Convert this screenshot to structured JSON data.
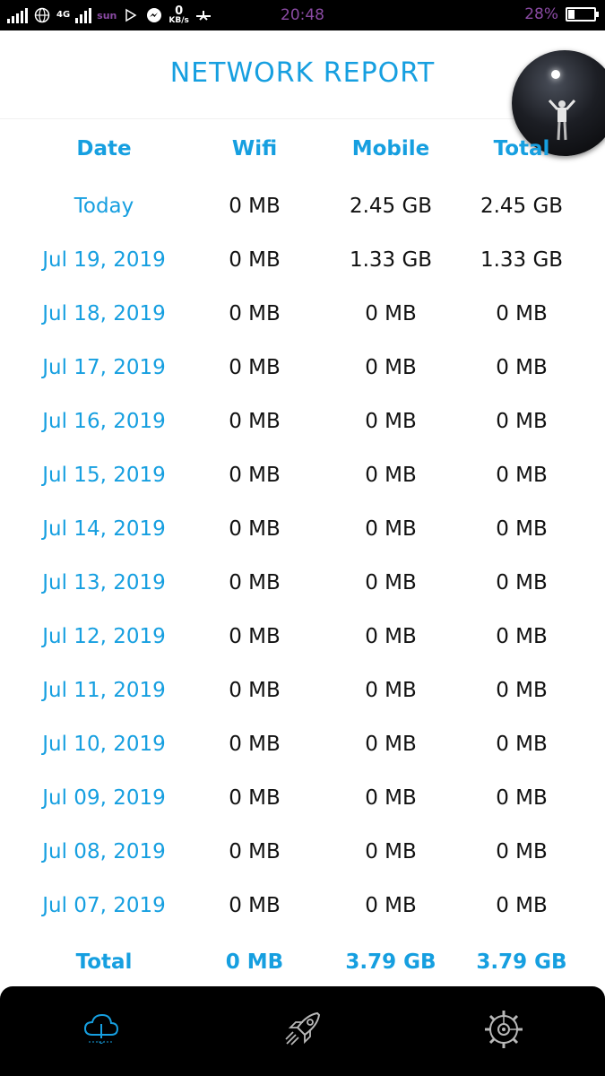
{
  "status_bar": {
    "network_tag": "4G",
    "carrier_label": "sun",
    "speed_value": "0",
    "speed_unit": "KB/s",
    "time": "20:48",
    "battery_percent": "28%",
    "battery_level": 0.28,
    "colors": {
      "time_text": "#8a4aa3"
    }
  },
  "header": {
    "title": "NETWORK REPORT"
  },
  "table": {
    "columns": [
      "Date",
      "Wifi",
      "Mobile",
      "Total"
    ],
    "rows": [
      {
        "date": "Today",
        "wifi": "0 MB",
        "mobile": "2.45 GB",
        "total": "2.45 GB"
      },
      {
        "date": "Jul 19, 2019",
        "wifi": "0 MB",
        "mobile": "1.33 GB",
        "total": "1.33 GB"
      },
      {
        "date": "Jul 18, 2019",
        "wifi": "0 MB",
        "mobile": "0 MB",
        "total": "0 MB"
      },
      {
        "date": "Jul 17, 2019",
        "wifi": "0 MB",
        "mobile": "0 MB",
        "total": "0 MB"
      },
      {
        "date": "Jul 16, 2019",
        "wifi": "0 MB",
        "mobile": "0 MB",
        "total": "0 MB"
      },
      {
        "date": "Jul 15, 2019",
        "wifi": "0 MB",
        "mobile": "0 MB",
        "total": "0 MB"
      },
      {
        "date": "Jul 14, 2019",
        "wifi": "0 MB",
        "mobile": "0 MB",
        "total": "0 MB"
      },
      {
        "date": "Jul 13, 2019",
        "wifi": "0 MB",
        "mobile": "0 MB",
        "total": "0 MB"
      },
      {
        "date": "Jul 12, 2019",
        "wifi": "0 MB",
        "mobile": "0 MB",
        "total": "0 MB"
      },
      {
        "date": "Jul 11, 2019",
        "wifi": "0 MB",
        "mobile": "0 MB",
        "total": "0 MB"
      },
      {
        "date": "Jul 10, 2019",
        "wifi": "0 MB",
        "mobile": "0 MB",
        "total": "0 MB"
      },
      {
        "date": "Jul 09, 2019",
        "wifi": "0 MB",
        "mobile": "0 MB",
        "total": "0 MB"
      },
      {
        "date": "Jul 08, 2019",
        "wifi": "0 MB",
        "mobile": "0 MB",
        "total": "0 MB"
      },
      {
        "date": "Jul 07, 2019",
        "wifi": "0 MB",
        "mobile": "0 MB",
        "total": "0 MB"
      }
    ],
    "total": {
      "label": "Total",
      "wifi": "0 MB",
      "mobile": "3.79 GB",
      "total": "3.79 GB"
    }
  },
  "bottom_nav": {
    "items": [
      {
        "icon": "cloud-download-icon",
        "active": true
      },
      {
        "icon": "rocket-icon",
        "active": false
      },
      {
        "icon": "gear-icon",
        "active": false
      }
    ],
    "colors": {
      "active": "#169fe0",
      "inactive": "#b8b8b8"
    }
  },
  "colors": {
    "accent": "#169fe0",
    "text": "#111111",
    "background": "#ffffff"
  }
}
